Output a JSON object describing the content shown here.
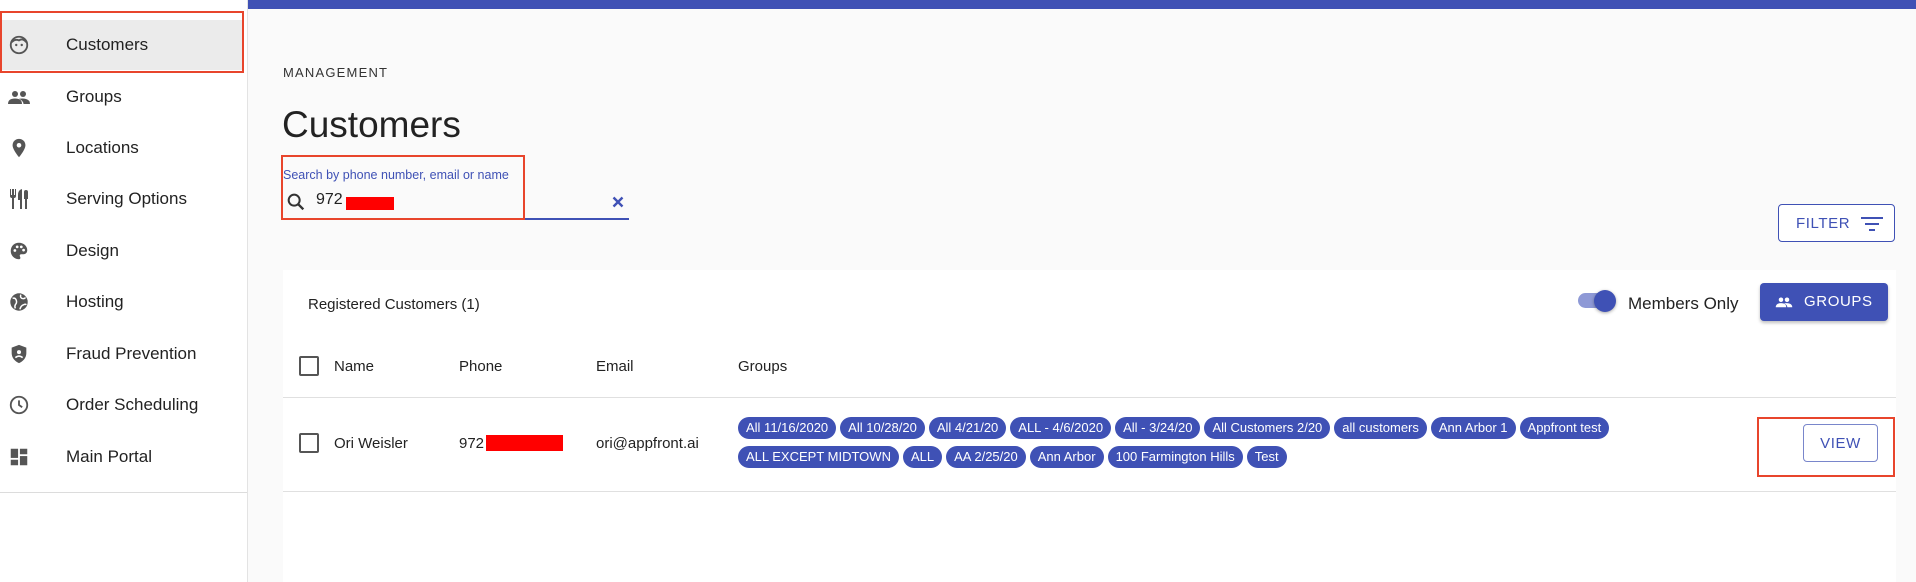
{
  "sidebar": {
    "items": [
      {
        "label": "Customers",
        "icon": "face-icon"
      },
      {
        "label": "Groups",
        "icon": "people-icon"
      },
      {
        "label": "Locations",
        "icon": "location-pin-icon"
      },
      {
        "label": "Serving Options",
        "icon": "utensils-icon"
      },
      {
        "label": "Design",
        "icon": "palette-icon"
      },
      {
        "label": "Hosting",
        "icon": "globe-icon"
      },
      {
        "label": "Fraud Prevention",
        "icon": "shield-icon"
      },
      {
        "label": "Order Scheduling",
        "icon": "clock-icon"
      },
      {
        "label": "Main Portal",
        "icon": "dashboard-icon"
      }
    ],
    "active_item": "Customers"
  },
  "colors": {
    "primary": "#3f51b5",
    "highlight": "#e8452c",
    "redaction": "#ff0000"
  },
  "page": {
    "overline": "MANAGEMENT",
    "title": "Customers"
  },
  "search": {
    "label": "Search by phone number, email or name",
    "value": "972"
  },
  "filter": {
    "label": "FILTER"
  },
  "table": {
    "title": "Registered Customers (1)",
    "members_only_label": "Members Only",
    "members_only": true,
    "groups_button": "GROUPS",
    "columns": [
      "Name",
      "Phone",
      "Email",
      "Groups"
    ],
    "rows": [
      {
        "name": "Ori Weisler",
        "phone": "972",
        "email": "ori@appfront.ai",
        "groups": [
          "All 11/16/2020",
          "All 10/28/20",
          "All 4/21/20",
          "ALL - 4/6/2020",
          "All - 3/24/20",
          "All Customers 2/20",
          "all customers",
          "Ann Arbor 1",
          "Appfront test",
          "ALL EXCEPT MIDTOWN",
          "ALL",
          "AA 2/25/20",
          "Ann Arbor",
          "100 Farmington Hills",
          "Test"
        ],
        "action": "VIEW"
      }
    ]
  }
}
